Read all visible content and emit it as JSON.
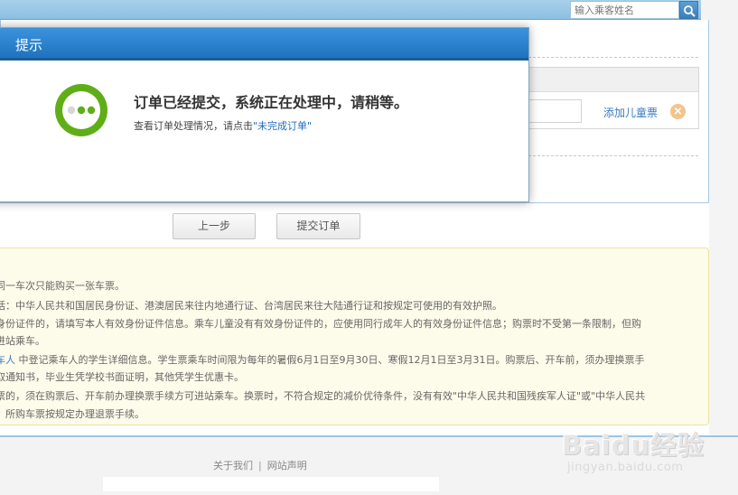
{
  "search": {
    "placeholder": "输入乘客姓名"
  },
  "passenger": {
    "add_child_label": "添加儿童票",
    "remove_icon": "×"
  },
  "buttons": {
    "prev_label": "上一步",
    "submit_label": "提交订单"
  },
  "notice": {
    "lines": [
      {
        "text": "同一车次只能购买一张车票。"
      },
      {
        "text": "括：中华人民共和国居民身份证、港澳居民来往内地通行证、台湾居民来往大陆通行证和按规定可使用的有效护照。"
      },
      {
        "text": "身份证件的，请填写本人有效身份证件信息。乘车儿童没有有效身份证件的，应使用同行成年人的有效身份证件信息；购票时不受第一条限制，但购"
      },
      {
        "text": "进站乘车。"
      },
      {
        "prefix": "车人",
        "text": " 中登记乘车人的学生详细信息。学生票乘车时间限为每年的暑假6月1日至9月30日、寒假12月1日至3月31日。购票后、开车前，须办理换票手"
      },
      {
        "text": "取通知书，毕业生凭学校书面证明，其他凭学生优惠卡。"
      },
      {
        "text": "票的，须在购票后、开车前办理换票手续方可进站乘车。换票时，不符合规定的减价优待条件，没有有效\"中华人民共和国残疾军人证\"或\"中华人民共"
      },
      {
        "text": "，所购车票按规定办理退票手续。"
      }
    ]
  },
  "footer": {
    "about_label": "关于我们",
    "separator": "|",
    "statement_label": "网站声明"
  },
  "watermark": {
    "main": "Baidu经验",
    "sub": "jingyan.baidu.com"
  },
  "modal": {
    "title": "提示",
    "message": "订单已经提交，系统正在处理中，请稍等。",
    "sub_prefix": "查看订单处理情况，请点击",
    "sub_link": "\"未完成订单\"",
    "icon": "loading-dots-icon",
    "accent_color": "#5fae18"
  }
}
